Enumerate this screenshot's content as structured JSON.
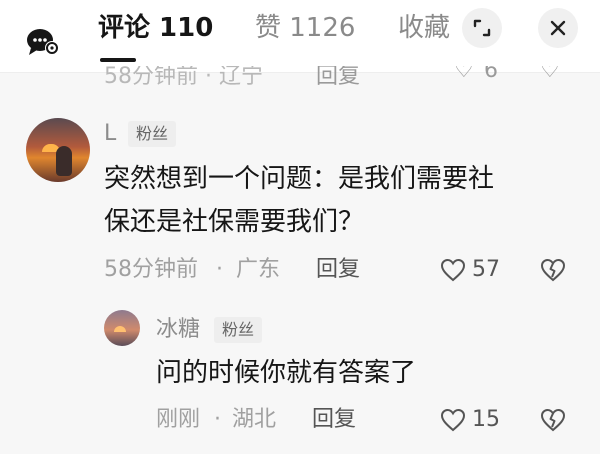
{
  "header": {
    "tabs": [
      {
        "label": "评论 110"
      },
      {
        "label": "赞 1126"
      },
      {
        "label": "收藏"
      }
    ]
  },
  "previous_comment": {
    "time_location": "58分钟前 · 辽宁",
    "reply_label": "回复",
    "likes": "6"
  },
  "comment": {
    "username": "L",
    "badge": "粉丝",
    "text_line1": "突然想到一个问题：是我们需要社",
    "text_line2": "保还是社保需要我们？",
    "time": "58分钟前",
    "location": "广东",
    "reply_label": "回复",
    "likes": "57"
  },
  "reply": {
    "username": "冰糖",
    "badge": "粉丝",
    "text": "问的时候你就有答案了",
    "time": "刚刚",
    "location": "湖北",
    "reply_label": "回复",
    "likes": "15"
  }
}
